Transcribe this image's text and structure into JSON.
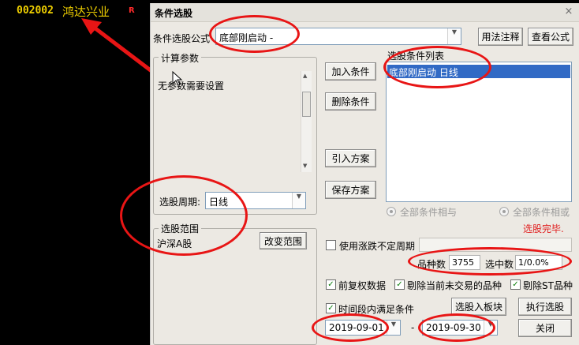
{
  "stock": {
    "code": "002002",
    "name": "鸿达兴业",
    "tag": "R"
  },
  "dialog": {
    "title": "条件选股",
    "close_glyph": "×",
    "formula": {
      "label": "条件选股公式",
      "value": "底部刚启动  -"
    },
    "buttons": {
      "usage": "用法注释",
      "view_formula": "查看公式",
      "add": "加入条件",
      "delete": "删除条件",
      "import": "引入方案",
      "save": "保存方案",
      "change_range": "改变范围",
      "to_block": "选股入板块",
      "execute": "执行选股",
      "close": "关闭"
    },
    "params": {
      "title": "计算参数",
      "text": "无参数需要设置"
    },
    "period": {
      "label": "选股周期:",
      "value": "日线"
    },
    "range": {
      "title": "选股范围",
      "value": "沪深A股"
    },
    "conditions": {
      "title": "选股条件列表",
      "items": [
        {
          "text": "底部刚启动  日线"
        }
      ]
    },
    "logic": {
      "all_and": "全部条件相与",
      "all_or": "全部条件相或"
    },
    "status": "选股完毕.",
    "uncertain_period": "使用涨跌不定周期",
    "stats": {
      "count_label": "品种数",
      "count_value": "3755",
      "hit_label": "选中数",
      "hit_value": "1/0.0%"
    },
    "options": {
      "fuquan": "前复权数据",
      "exclude_untraded": "剔除当前未交易的品种",
      "exclude_st": "剔除ST品种",
      "in_period": "时间段内满足条件"
    },
    "dates": {
      "from": "2019-09-01",
      "dash": "-",
      "to": "2019-09-30"
    }
  },
  "colors": {
    "accent": "#316ac5",
    "annotation": "#e81515",
    "status": "#e02020",
    "stock_yellow": "#f0d000"
  }
}
